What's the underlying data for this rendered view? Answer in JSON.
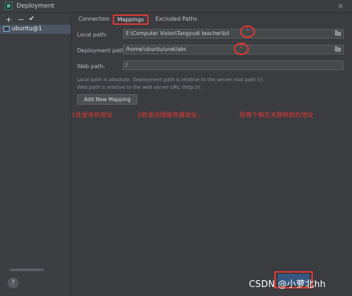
{
  "window": {
    "title": "Deployment",
    "close_glyph": "×"
  },
  "left_panel": {
    "toolbar": {
      "add": "+",
      "remove": "−",
      "confirm": "✔"
    },
    "server": {
      "label": "ubuntu@1"
    },
    "help": "?"
  },
  "tabs": [
    {
      "label": "Connection"
    },
    {
      "label": "Mappings"
    },
    {
      "label": "Excluded Paths"
    }
  ],
  "mappings": {
    "local_path": {
      "label": "Local path:",
      "value": "E:\\Computer Vision\\Tangyudi teacher\\bil"
    },
    "deployment_path": {
      "label": "Deployment path:",
      "value": "/home/ubuntu/unet/abc"
    },
    "web_path": {
      "label": "Web path:",
      "value": "/"
    },
    "note_line1": "Local path is absolute. Deployment path is relative to the server root path (/).",
    "note_line2": "Web path is relative to the web server URL (http://).",
    "add_button": "Add New Mapping"
  },
  "annotations": {
    "note1": "1处是本机地址",
    "note2": "2处是远程服务器地址，",
    "note3": "是两个相互关联映射的地址",
    "circle1": "1",
    "circle2": "2",
    "color": "#e53935"
  },
  "watermark": "CSDN @小萝北hh",
  "colors": {
    "background": "#3a3c3f",
    "panel": "#3c3f41",
    "accent_red": "#e53935",
    "ok_button": "#365880"
  }
}
